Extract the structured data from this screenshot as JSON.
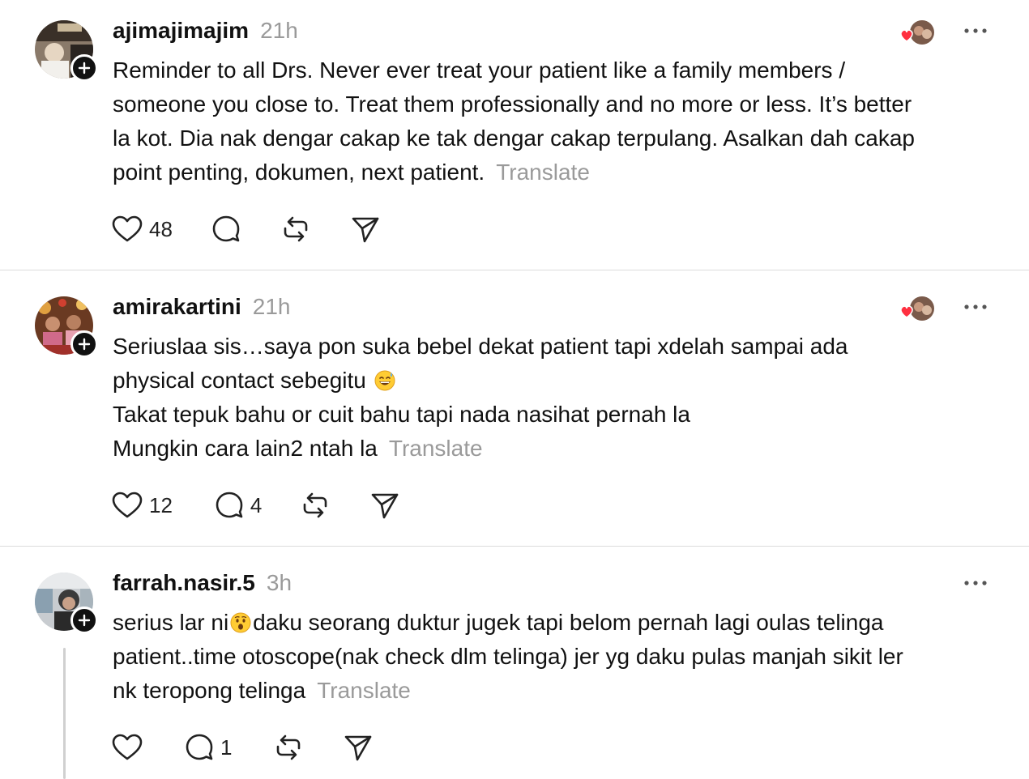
{
  "posts": [
    {
      "username": "ajimajimajim",
      "time": "21h",
      "lines": [
        "Reminder to all Drs. Never ever treat your patient like a family members /",
        "someone you close to. Treat them professionally and no more or less. It’s better",
        "la kot. Dia nak dengar cakap ke tak dengar cakap terpulang. Asalkan dah cakap",
        "point penting, dokumen, next patient."
      ],
      "translate": "Translate",
      "likes": "48",
      "replies": "",
      "has_liked_avatars": true
    },
    {
      "username": "amirakartini",
      "time": "21h",
      "lines": [
        "Seriuslaa sis…saya pon suka bebel dekat patient tapi xdelah sampai ada",
        "physical contact sebegitu",
        "Takat tepuk bahu or cuit bahu tapi nada nasihat pernah la",
        "Mungkin cara lain2 ntah la"
      ],
      "translate": "Translate",
      "likes": "12",
      "replies": "4",
      "has_liked_avatars": true
    },
    {
      "username": "farrah.nasir.5",
      "time": "3h",
      "lines": [
        "serius lar ni",
        "daku seorang duktur jugek tapi belom pernah lagi oulas telinga",
        "patient..time otoscope(nak check dlm telinga) jer yg daku pulas manjah sikit ler",
        "nk teropong telinga"
      ],
      "translate": "Translate",
      "likes": "",
      "replies": "1",
      "has_liked_avatars": false
    }
  ],
  "icons": {
    "like": "heart-icon",
    "reply": "speech-bubble-icon",
    "repost": "repost-icon",
    "share": "send-icon",
    "more": "more-horizontal-icon",
    "follow": "plus-icon",
    "emoji_sweat": "grinning-sweat-emoji",
    "emoji_astonished": "hushed-face-emoji"
  },
  "colors": {
    "text": "#111111",
    "muted": "#9a9a9a",
    "divider": "#dcdcdc",
    "liked_heart": "#ff3040"
  }
}
